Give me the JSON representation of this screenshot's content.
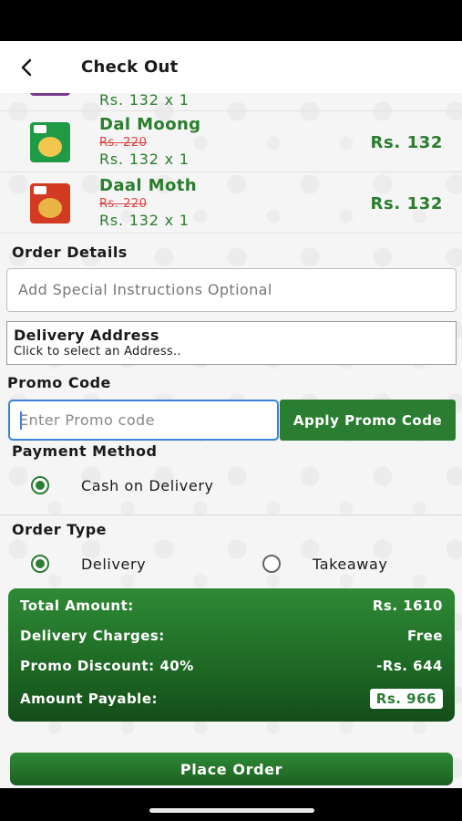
{
  "header": {
    "title": "Check Out"
  },
  "items": [
    {
      "qty_line": "Rs. 132 x 1"
    },
    {
      "name": "Dal Moong",
      "old_price": "Rs. 220",
      "qty_line": "Rs. 132 x 1",
      "price": "Rs. 132"
    },
    {
      "name": "Daal Moth",
      "old_price": "Rs. 220",
      "qty_line": "Rs. 132 x 1",
      "price": "Rs. 132"
    }
  ],
  "order_details": {
    "label": "Order Details",
    "instructions_placeholder": "Add Special Instructions Optional",
    "address_title": "Delivery Address",
    "address_hint": "Click to select an Address.."
  },
  "promo": {
    "label": "Promo Code",
    "placeholder": "Enter Promo code",
    "apply_label": "Apply Promo Code"
  },
  "payment": {
    "label": "Payment Method",
    "options": [
      {
        "label": "Cash on Delivery",
        "selected": true
      }
    ]
  },
  "order_type": {
    "label": "Order Type",
    "options": [
      {
        "label": "Delivery",
        "selected": true
      },
      {
        "label": "Takeaway",
        "selected": false
      }
    ]
  },
  "summary": {
    "total_label": "Total Amount:",
    "total_value": "Rs. 1610",
    "delivery_label": "Delivery Charges:",
    "delivery_value": "Free",
    "discount_label": "Promo Discount: 40%",
    "discount_value": "-Rs. 644",
    "payable_label": "Amount Payable:",
    "payable_value": "Rs. 966"
  },
  "place_order_label": "Place Order",
  "icons": {
    "back": "back-arrow-icon"
  },
  "colors": {
    "accent": "#2b7d32",
    "strike": "#d44444",
    "focus": "#3b82d8"
  }
}
